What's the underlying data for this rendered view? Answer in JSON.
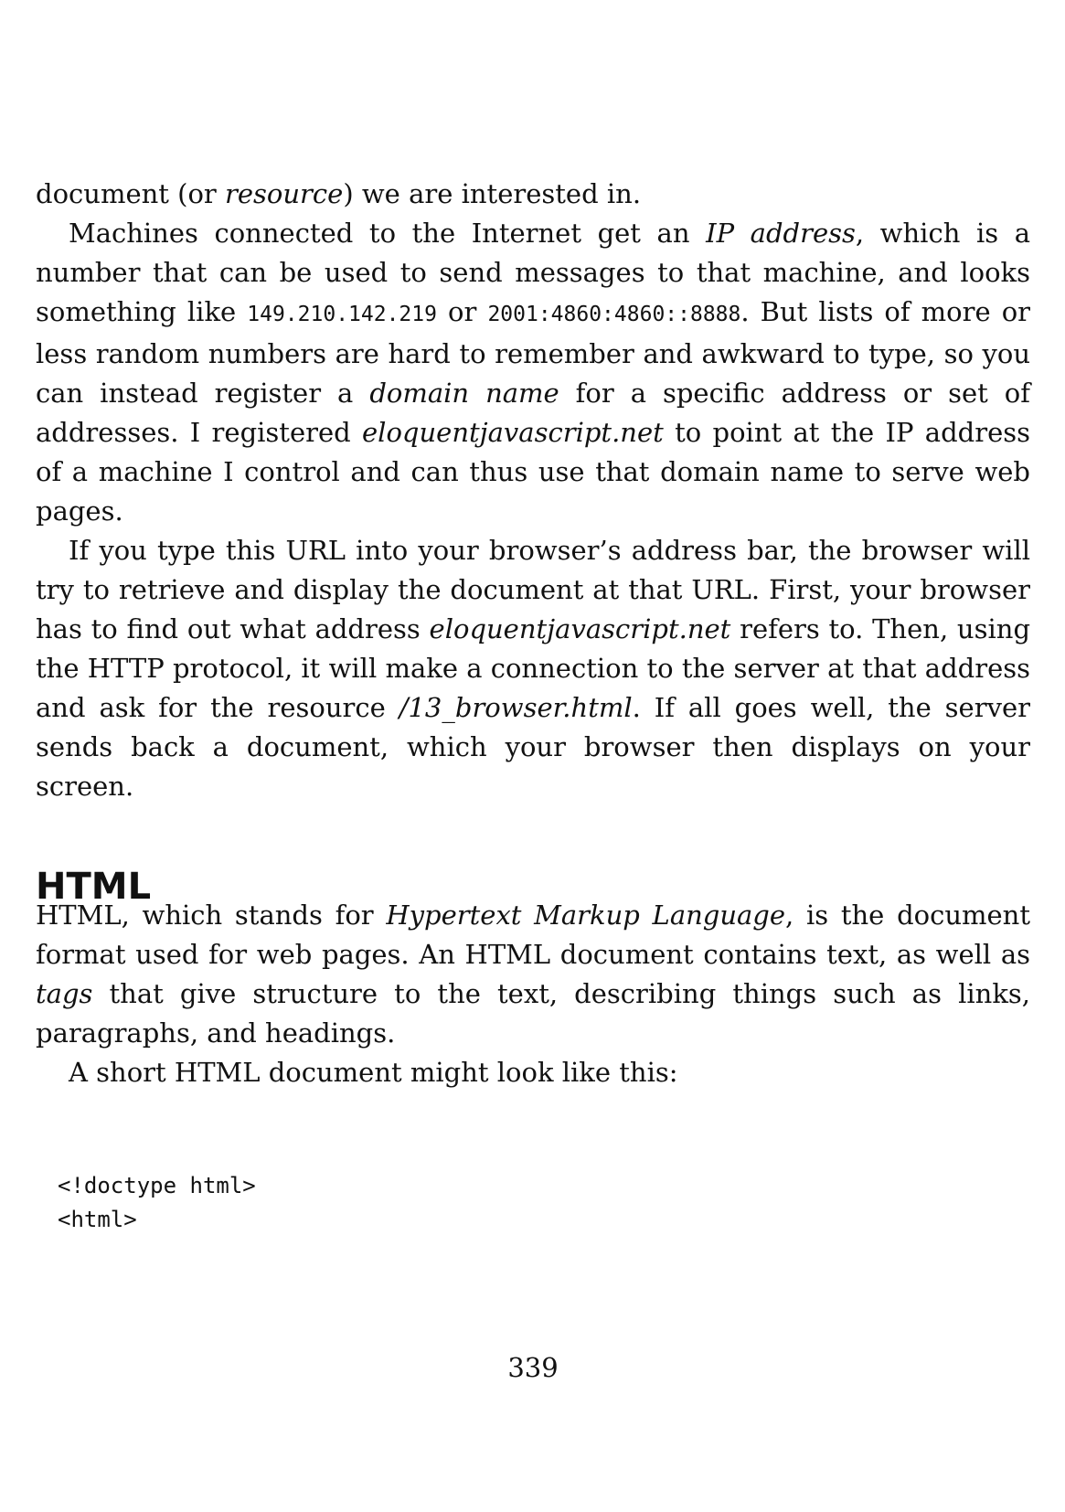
{
  "section1": {
    "p1": {
      "a": "document (or ",
      "em1": "resource",
      "b": ") we are interested in."
    },
    "p2": {
      "a": "Machines connected to the Internet get an ",
      "em1": "IP address",
      "b": ", which is a number that can be used to send messages to that machine, and looks something like ",
      "code1": "149.210.142.219",
      "c": " or ",
      "code2": "2001:4860:4860::8888",
      "d": ". But lists of more or less random numbers are hard to remember and awkward to type, so you can instead register a ",
      "em2": "domain name",
      "e": " for a specific address or set of addresses. I registered ",
      "em3": "eloquentjavascript.net",
      "f": " to point at the IP address of a machine I control and can thus use that domain name to serve web pages."
    },
    "p3": {
      "a": "If you type this URL into your browser’s address bar, the browser will try to retrieve and display the document at that URL. First, your browser has to find out what address ",
      "em1": "eloquentjavascript.net",
      "b": " refers to. Then, using the HTTP protocol, it will make a connection to the server at that address and ask for the resource ",
      "em2": "/13_browser.html",
      "c": ". If all goes well, the server sends back a document, which your browser then displays on your screen."
    }
  },
  "heading": "HTML",
  "section2": {
    "p1": {
      "a": "HTML, which stands for ",
      "em1": "Hypertext Markup Language",
      "b": ", is the document format used for web pages. An HTML document contains text, as well as ",
      "em2": "tags",
      "c": " that give structure to the text, describing things such as links, paragraphs, and headings."
    },
    "p2": "A short HTML document might look like this:"
  },
  "code": "<!doctype html>\n<html>",
  "page_number": "339"
}
